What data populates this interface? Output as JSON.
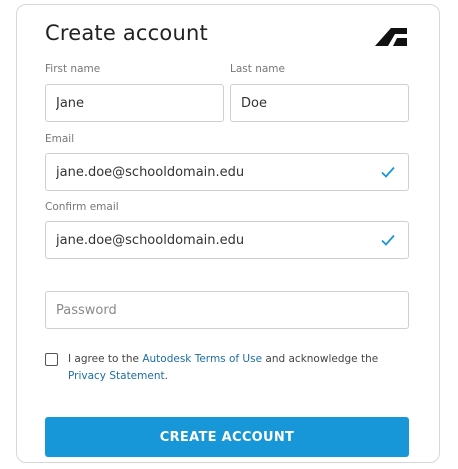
{
  "form": {
    "title": "Create account",
    "first_name": {
      "label": "First name",
      "value": "Jane"
    },
    "last_name": {
      "label": "Last name",
      "value": "Doe"
    },
    "email": {
      "label": "Email",
      "value": "jane.doe@schooldomain.edu"
    },
    "confirm_email": {
      "label": "Confirm email",
      "value": "jane.doe@schooldomain.edu"
    },
    "password": {
      "placeholder": "Password",
      "value": ""
    },
    "agree": {
      "text_1": "I agree to the ",
      "terms_link": "Autodesk Terms of Use",
      "text_2": " and acknowledge the ",
      "privacy_link": "Privacy Statement",
      "text_3": "."
    },
    "submit_label": "CREATE ACCOUNT"
  },
  "colors": {
    "accent": "#1796d8",
    "link": "#1c6ea4",
    "check": "#1796d8"
  },
  "icons": {
    "logo": "autodesk-logo",
    "valid": "checkmark-icon"
  }
}
